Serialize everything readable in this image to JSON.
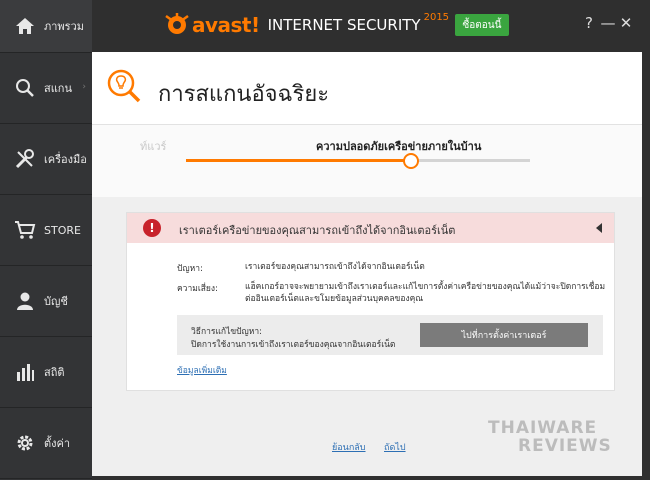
{
  "app": {
    "brand": "avast!",
    "product": "INTERNET SECURITY",
    "year": "2015",
    "buy_label": "ซื้อตอนนี้",
    "help": "?",
    "minimize": "—",
    "close": "✕"
  },
  "sidebar": {
    "items": [
      {
        "label": "ภาพรวม",
        "icon": "home-icon"
      },
      {
        "label": "สแกน",
        "icon": "search-icon"
      },
      {
        "label": "เครื่องมือ",
        "icon": "tools-icon"
      },
      {
        "label": "STORE",
        "icon": "cart-icon"
      },
      {
        "label": "บัญชี",
        "icon": "user-icon"
      },
      {
        "label": "สถิติ",
        "icon": "stats-icon"
      },
      {
        "label": "ตั้งค่า",
        "icon": "gear-icon"
      }
    ]
  },
  "page": {
    "title": "การสแกนอัจฉริยะ"
  },
  "steps": {
    "previous": "ท์แวร์",
    "current": "ความปลอดภัยเครือข่ายภายในบ้าน"
  },
  "issue": {
    "headline": "เราเตอร์เครือข่ายของคุณสามารถเข้าถึงได้จากอินเตอร์เน็ต",
    "problem_label": "ปัญหา:",
    "problem_text": "เราเตอร์ของคุณสามารถเข้าถึงได้จากอินเตอร์เน็ต",
    "risk_label": "ความเสี่ยง:",
    "risk_text": "แฮ็คเกอร์อาจจะพยายามเข้าถึงเราเตอร์และแก้ไขการตั้งค่าเครือข่ายของคุณได้แม้ว่าจะปิดการเชื่อมต่ออินเตอร์เน็ตและขโมยข้อมูลส่วนบุคคลของคุณ",
    "fix_title": "วิธีการแก้ไขปัญหา:",
    "fix_text": "ปิดการใช้งานการเข้าถึงเราเตอร์ของคุณจากอินเตอร์เน็ต",
    "fix_button": "ไปที่การตั้งค่าเราเตอร์",
    "more_link": "ข้อมูลเพิ่มเติม"
  },
  "nav": {
    "back": "ย้อนกลับ",
    "next": "ถัดไป"
  },
  "watermark": {
    "line1": "THAIWARE",
    "line2": "REVIEWS"
  },
  "colors": {
    "accent": "#ff7a00",
    "buy": "#3aa53f",
    "alert_bg": "#f7dcdc",
    "alert_icon": "#c8222b",
    "link": "#2d6fb4"
  }
}
